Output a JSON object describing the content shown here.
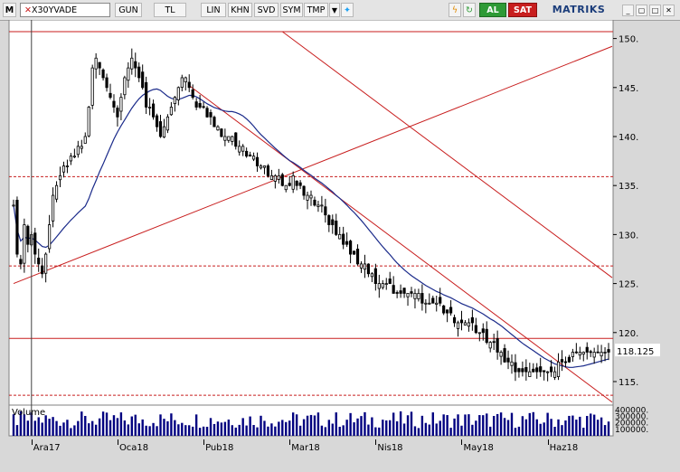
{
  "toolbar": {
    "logo_letter": "M",
    "symbol": "X30YVADE",
    "buttons": [
      "GUN",
      "TL",
      "LIN",
      "KHN",
      "SVD",
      "SYM",
      "TMP"
    ],
    "buy_label": "AL",
    "sell_label": "SAT",
    "brand": "MATRIKS",
    "colors": {
      "buy": "#2e9a36",
      "sell": "#c81e1e",
      "brand": "#1a3c7a"
    }
  },
  "chart_data": {
    "type": "candlestick",
    "price_axis": {
      "ticks": [
        "150.",
        "145.",
        "140.",
        "135.",
        "130.",
        "125.",
        "120.",
        "115."
      ],
      "tick_values": [
        150,
        145,
        140,
        135,
        130,
        125,
        120,
        115
      ],
      "last_price_label": "118.125",
      "last_price": 118.125,
      "ylim": [
        112.6,
        151.9
      ]
    },
    "x_labels": [
      "Ara17",
      "Oca18",
      "Pub18",
      "Mar18",
      "Nis18",
      "May18",
      "Haz18"
    ],
    "x_label_bar_index": [
      5,
      29,
      53,
      77,
      101,
      125,
      149
    ],
    "bar_count": 167,
    "closes": [
      133,
      128,
      127,
      131,
      129,
      130,
      128,
      127,
      126,
      128,
      131,
      134,
      135,
      136,
      137,
      137,
      138,
      138,
      139,
      139,
      140,
      143,
      147,
      148,
      147,
      146,
      145,
      144,
      143,
      142,
      144,
      146,
      147,
      148,
      147,
      146,
      145,
      143,
      143,
      142,
      141,
      140,
      141,
      142,
      143,
      144,
      145,
      146,
      146,
      145,
      144,
      143,
      143,
      143,
      142,
      142,
      141,
      141,
      140,
      140,
      140,
      140,
      139,
      139,
      139,
      138,
      138,
      138,
      137,
      137,
      137,
      136,
      136,
      136,
      136,
      135,
      135,
      135,
      136,
      135,
      135,
      134,
      134,
      134,
      133,
      133,
      133,
      132,
      131,
      131,
      130,
      130,
      129,
      129,
      128,
      128,
      127,
      127,
      127,
      126,
      126,
      125,
      125,
      125,
      125,
      125,
      124,
      124,
      124,
      124,
      124,
      124,
      124,
      124,
      123,
      123,
      123,
      123,
      123,
      123,
      122,
      122,
      122,
      121,
      121,
      121,
      121,
      121,
      121,
      120,
      120,
      120,
      119,
      119,
      119,
      118,
      118,
      117,
      117,
      117,
      116,
      116,
      116,
      116,
      116,
      116,
      116,
      116,
      116,
      116,
      116,
      116,
      117,
      117,
      117,
      117,
      118,
      118,
      118,
      118,
      118,
      118,
      118,
      118,
      118,
      118,
      118
    ],
    "volume": {
      "label": "Volume",
      "ticks": [
        "400000.",
        "300000.",
        "200000.",
        "100000."
      ],
      "tick_values": [
        400000,
        300000,
        200000,
        100000
      ],
      "max": 420000
    },
    "horizontal_lines": [
      {
        "value": 150.7,
        "style": "solid",
        "color": "#c81e1e"
      },
      {
        "value": 135.9,
        "style": "dashed",
        "color": "#c81e1e"
      },
      {
        "value": 126.8,
        "style": "dashed",
        "color": "#c81e1e"
      },
      {
        "value": 119.4,
        "style": "solid",
        "color": "#c81e1e"
      },
      {
        "value": 113.6,
        "style": "dashed",
        "color": "#c81e1e"
      }
    ],
    "trend_lines": [
      {
        "from": {
          "bar": 0,
          "value": 125.0
        },
        "to": {
          "bar": 167,
          "value": 149.2
        },
        "color": "#c81e1e"
      },
      {
        "from": {
          "bar": 75,
          "value": 150.7
        },
        "to": {
          "bar": 167,
          "value": 125.6
        },
        "color": "#c81e1e"
      },
      {
        "from": {
          "bar": 49,
          "value": 145.2
        },
        "to": {
          "bar": 167,
          "value": 112.9
        },
        "color": "#c81e1e"
      }
    ],
    "moving_average_color": "#1a2a8a",
    "vertical_marker_bar": 5,
    "grid": false,
    "colors": {
      "up": "#ffffff",
      "down": "#000000",
      "background": "#ffffff",
      "volume": "#000080"
    }
  }
}
